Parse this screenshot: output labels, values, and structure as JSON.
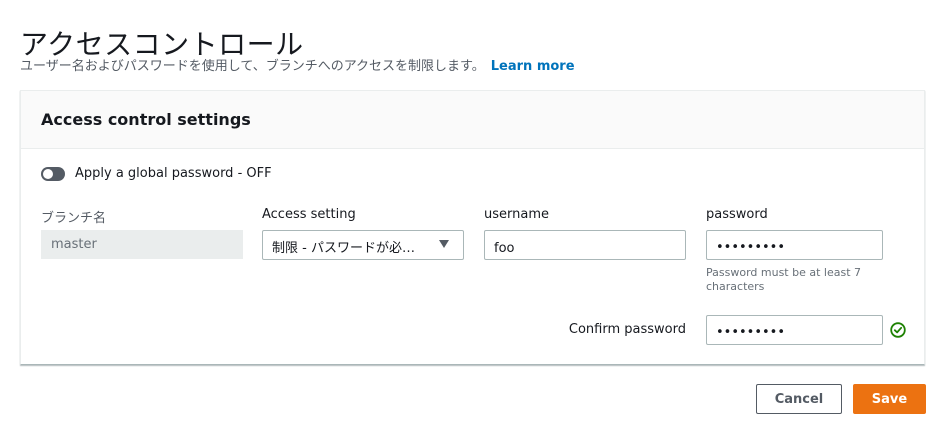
{
  "page": {
    "title": "アクセスコントロール",
    "description": "ユーザー名およびパスワードを使用して、ブランチへのアクセスを制限します。",
    "learn_more": "Learn more"
  },
  "panel": {
    "title": "Access control settings",
    "toggle_label": "Apply a global password - OFF",
    "columns": {
      "branch": "ブランチ名",
      "access": "Access setting",
      "username": "username",
      "password": "password"
    },
    "row": {
      "branch": "master",
      "access": "制限 - パスワードが必…",
      "username": "foo",
      "password": "•••••••••",
      "password_hint": "Password must be at least 7 characters"
    },
    "confirm": {
      "label": "Confirm password",
      "value": "•••••••••"
    }
  },
  "buttons": {
    "cancel": "Cancel",
    "save": "Save"
  },
  "icons": {
    "check": "check-circle-icon",
    "caret": "caret-down-icon"
  },
  "colors": {
    "accent": "#ec7211",
    "link": "#0073bb",
    "success": "#1d8102"
  }
}
